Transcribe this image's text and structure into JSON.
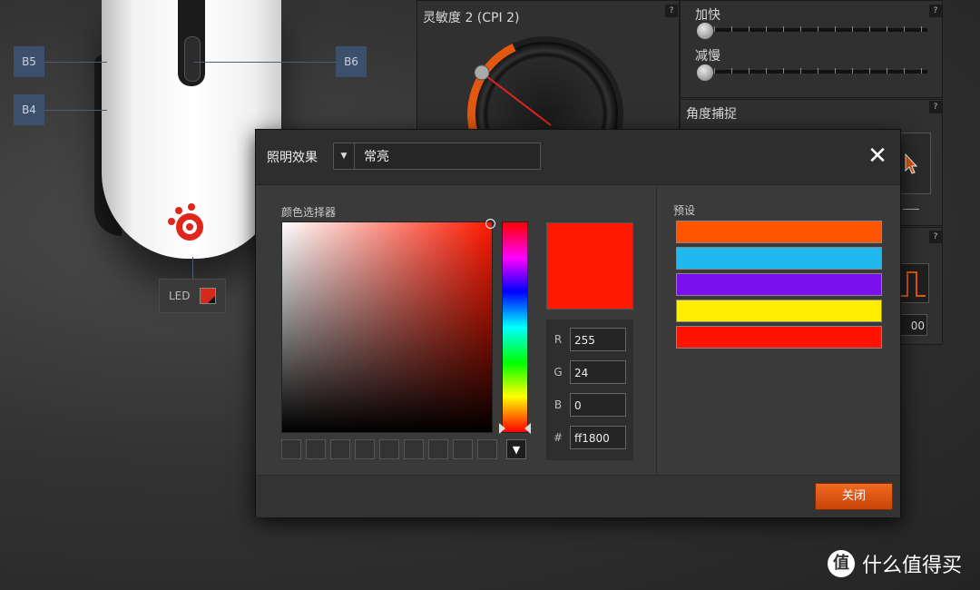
{
  "mouse_buttons": {
    "b5": "B5",
    "b6": "B6",
    "b4": "B4"
  },
  "led": {
    "label": "LED",
    "color": "#d52a1b"
  },
  "sensitivity": {
    "title": "灵敏度 2 (CPI 2)",
    "help": "?"
  },
  "acceleration": {
    "speed_up_label": "加快",
    "slow_down_label": "减慢",
    "help": "?"
  },
  "angle_snapping": {
    "title": "角度捕捉",
    "help": "?"
  },
  "mini_panel": {
    "help": "?",
    "value": "00"
  },
  "dialog": {
    "title": "照明效果",
    "effect_select": {
      "value": "常亮",
      "arrow": "▼"
    },
    "close_icon": "✕",
    "color_picker": {
      "label": "颜色选择器",
      "current_color": "#ff1800",
      "r_label": "R",
      "r_value": "255",
      "g_label": "G",
      "g_value": "24",
      "b_label": "B",
      "b_value": "0",
      "hex_label": "#",
      "hex_value": "ff1800",
      "swatch_more": "▼"
    },
    "presets": {
      "label": "预设",
      "colors": [
        "#ff5500",
        "#21b8ee",
        "#7a10ee",
        "#ffee00",
        "#ff1200"
      ]
    },
    "close_button": "关闭"
  },
  "watermark": {
    "logo": "值",
    "text": "什么值得买"
  }
}
